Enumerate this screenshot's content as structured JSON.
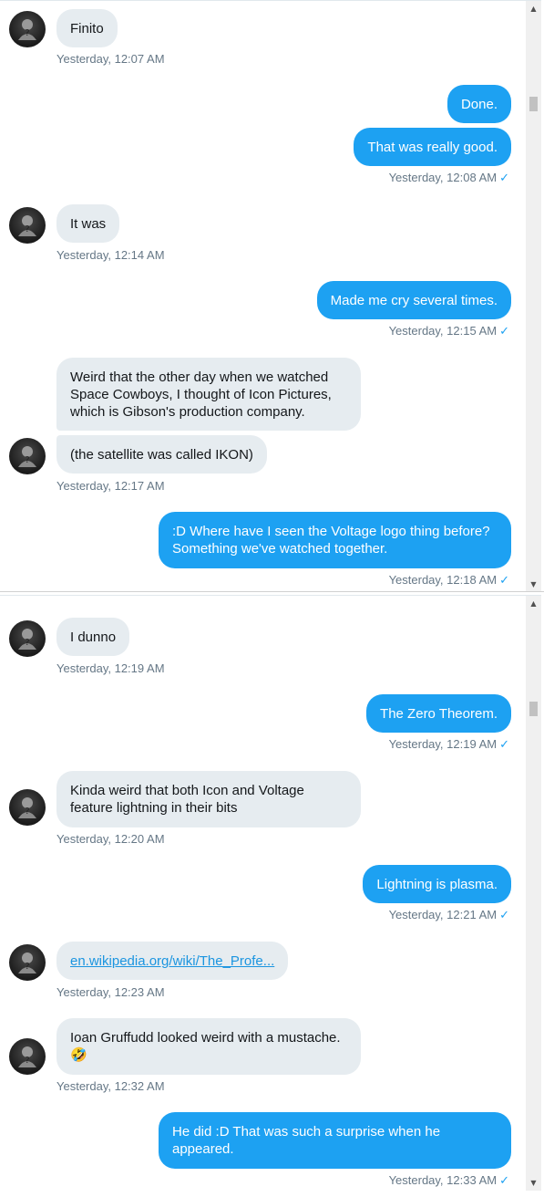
{
  "status_colors": {
    "sent_bubble": "#1da1f2",
    "received_bubble": "#e6ecf0",
    "check": "#1da1f2"
  },
  "panel1": {
    "messages": [
      {
        "text": "Finito",
        "time": "Yesterday, 12:07 AM"
      },
      {
        "text": "Done."
      },
      {
        "text": "That was really good.",
        "time": "Yesterday, 12:08 AM"
      },
      {
        "text": "It was",
        "time": "Yesterday, 12:14 AM"
      },
      {
        "text": "Made me cry several times.",
        "time": "Yesterday, 12:15 AM"
      },
      {
        "lines": [
          "Weird that the other day when we watched",
          "Space Cowboys, I thought of Icon Pictures,",
          "which is Gibson's production company."
        ]
      },
      {
        "text": "(the satellite was called IKON)",
        "time": "Yesterday, 12:17 AM"
      },
      {
        "lines": [
          ":D Where have I seen the Voltage logo thing before?",
          "Something we've watched together."
        ],
        "time": "Yesterday, 12:18 AM"
      }
    ]
  },
  "panel2": {
    "messages": [
      {
        "text": "I dunno",
        "time": "Yesterday, 12:19 AM"
      },
      {
        "text": "The Zero Theorem.",
        "time": "Yesterday, 12:19 AM"
      },
      {
        "lines": [
          "Kinda weird that both Icon and Voltage",
          "feature lightning in their bits"
        ],
        "time": "Yesterday, 12:20 AM"
      },
      {
        "text": "Lightning is plasma.",
        "time": "Yesterday, 12:21 AM"
      },
      {
        "link": "en.wikipedia.org/wiki/The_Profe...",
        "time": "Yesterday, 12:23 AM"
      },
      {
        "lines": [
          "Ioan Gruffudd looked weird with a mustache.",
          "🤣"
        ],
        "time": "Yesterday, 12:32 AM"
      },
      {
        "lines": [
          "He did :D That was such a surprise when he",
          "appeared."
        ],
        "time": "Yesterday, 12:33 AM"
      }
    ]
  },
  "icons": {
    "read_check": "✓",
    "scroll_up": "▲",
    "scroll_down": "▼"
  }
}
